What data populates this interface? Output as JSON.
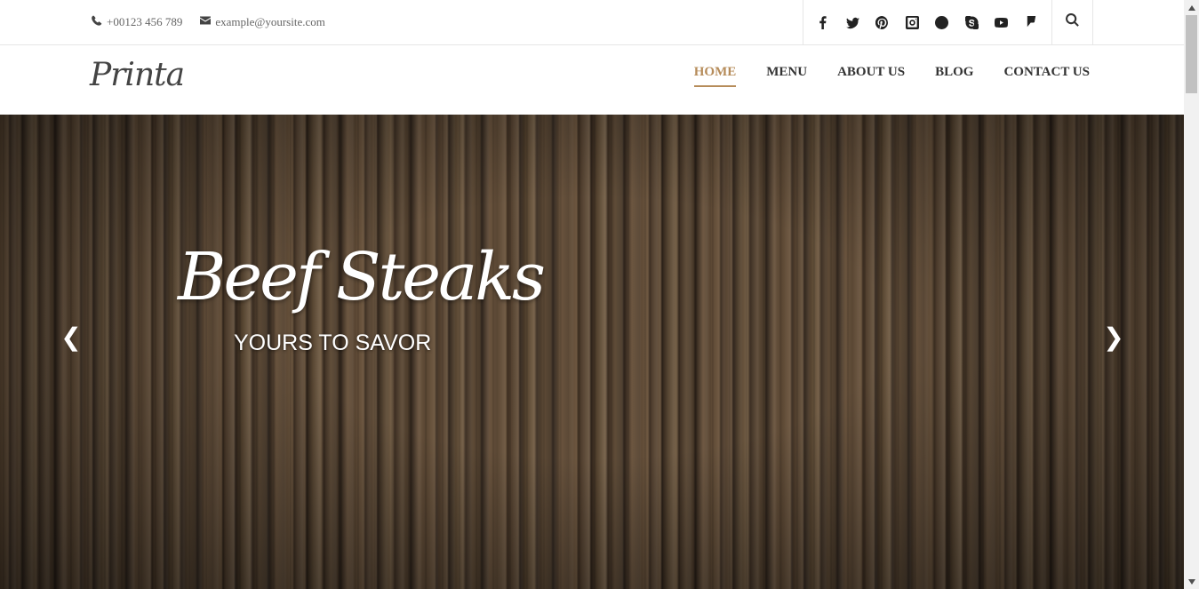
{
  "topbar": {
    "phone": "+00123 456 789",
    "email": "example@yoursite.com",
    "social_icons": [
      "facebook-icon",
      "twitter-icon",
      "pinterest-icon",
      "instagram-icon",
      "google-plus-icon",
      "skype-icon",
      "youtube-icon",
      "foursquare-icon"
    ],
    "search_icon": "search-icon"
  },
  "header": {
    "logo": "Printa",
    "nav": [
      {
        "label": "HOME",
        "active": true
      },
      {
        "label": "MENU",
        "active": false
      },
      {
        "label": "ABOUT US",
        "active": false
      },
      {
        "label": "BLOG",
        "active": false
      },
      {
        "label": "CONTACT US",
        "active": false
      }
    ]
  },
  "hero": {
    "title": "Beef Steaks",
    "subtitle": "YOURS TO SAVOR",
    "prev_arrow": "❮",
    "next_arrow": "❯"
  },
  "colors": {
    "accent": "#b68c5a",
    "nav_text": "#333333",
    "border": "#e6e6e6"
  }
}
